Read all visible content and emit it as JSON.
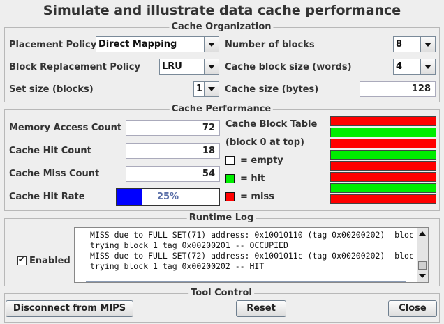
{
  "title": "Simulate and illustrate data cache performance",
  "cache_organization": {
    "legend": "Cache Organization",
    "placement_policy": {
      "label": "Placement Policy",
      "value": "Direct Mapping"
    },
    "replacement_policy": {
      "label": "Block Replacement Policy",
      "value": "LRU"
    },
    "set_size": {
      "label": "Set size (blocks)",
      "value": "1"
    },
    "num_blocks": {
      "label": "Number of blocks",
      "value": "8"
    },
    "block_size": {
      "label": "Cache block size (words)",
      "value": "4"
    },
    "cache_size": {
      "label": "Cache size (bytes)",
      "value": "128"
    }
  },
  "cache_performance": {
    "legend": "Cache Performance",
    "memory_access_count": {
      "label": "Memory Access Count",
      "value": "72"
    },
    "hit_count": {
      "label": "Cache Hit Count",
      "value": "18"
    },
    "miss_count": {
      "label": "Cache Miss Count",
      "value": "54"
    },
    "hit_rate": {
      "label": "Cache Hit Rate",
      "text": "25%",
      "fraction": 0.25,
      "bar_color": "#0000ff"
    },
    "block_table": {
      "title_line1": "Cache Block Table",
      "title_line2": "(block 0 at top)",
      "legend_empty": "= empty",
      "legend_hit": "= hit",
      "legend_miss": "= miss",
      "colors": {
        "empty": "#ffffff",
        "hit": "#00ee00",
        "miss": "#ff0000"
      },
      "blocks": [
        "miss",
        "hit",
        "miss",
        "hit",
        "miss",
        "miss",
        "hit",
        "miss"
      ]
    }
  },
  "runtime_log": {
    "legend": "Runtime Log",
    "enabled_label": "Enabled",
    "enabled": true,
    "lines": [
      "MISS due to FULL SET(71) address: 0x10010110 (tag 0x00200202)  bloc",
      "trying block 1 tag 0x00200201 -- OCCUPIED",
      "MISS due to FULL SET(72) address: 0x1001011c (tag 0x00200202)  bloc",
      "trying block 1 tag 0x00200202 -- HIT"
    ]
  },
  "tool_control": {
    "legend": "Tool Control",
    "disconnect_label": "Disconnect from MIPS",
    "reset_label": "Reset",
    "close_label": "Close"
  }
}
